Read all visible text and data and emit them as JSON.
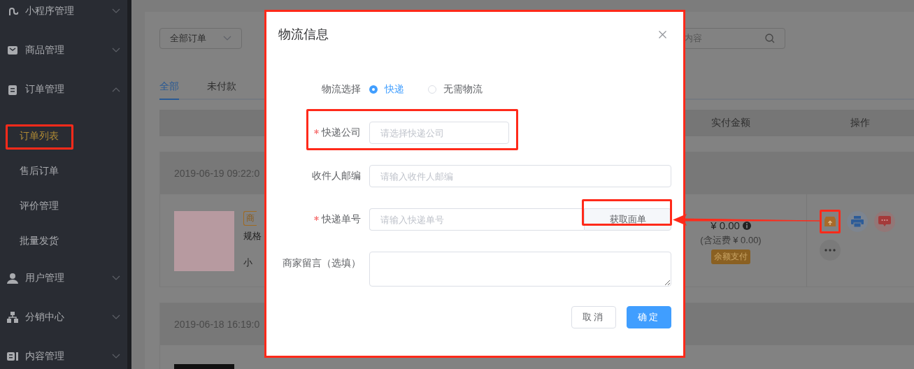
{
  "sidebar": {
    "items": [
      {
        "label": "小程序管理",
        "expanded": false
      },
      {
        "label": "商品管理",
        "expanded": false
      },
      {
        "label": "订单管理",
        "expanded": true,
        "children": [
          {
            "label": "订单列表",
            "selected": true
          },
          {
            "label": "售后订单",
            "selected": false
          },
          {
            "label": "评价管理",
            "selected": false
          },
          {
            "label": "批量发货",
            "selected": false
          }
        ]
      },
      {
        "label": "用户管理",
        "expanded": false
      },
      {
        "label": "分销中心",
        "expanded": false
      },
      {
        "label": "内容管理",
        "expanded": false
      }
    ]
  },
  "filters": {
    "order_type": "全部订单",
    "search_placeholder": "内容"
  },
  "tabs": [
    {
      "label": "全部",
      "selected": true
    },
    {
      "label": "未付款",
      "selected": false
    }
  ],
  "table": {
    "columns": [
      "实付金额",
      "操作"
    ]
  },
  "orders": [
    {
      "time": "2019-06-19 09:22:0",
      "tag": "商",
      "spec": "规格",
      "subtotal": "小",
      "price": "¥ 0.00",
      "shipping": "(含运费 ¥ 0.00)",
      "payment": "余额支付"
    },
    {
      "time": "2019-06-18 16:19:0"
    }
  ],
  "dialog": {
    "title": "物流信息",
    "fields": [
      {
        "kind": "radio",
        "label": "物流选择",
        "options": [
          {
            "label": "快递",
            "selected": true
          },
          {
            "label": "无需物流",
            "selected": false
          }
        ]
      },
      {
        "kind": "select",
        "label": "快递公司",
        "required": true,
        "placeholder": "请选择快递公司"
      },
      {
        "kind": "input",
        "label": "收件人邮编",
        "required": false,
        "placeholder": "请输入收件人邮编"
      },
      {
        "kind": "input_button",
        "label": "快递单号",
        "required": true,
        "placeholder": "请输入快递单号",
        "button": "获取面单"
      },
      {
        "kind": "textarea",
        "label": "商家留言（选填）",
        "required": false
      }
    ],
    "buttons": [
      {
        "label": "取消",
        "kind": "default"
      },
      {
        "label": "确定",
        "kind": "primary"
      }
    ]
  }
}
